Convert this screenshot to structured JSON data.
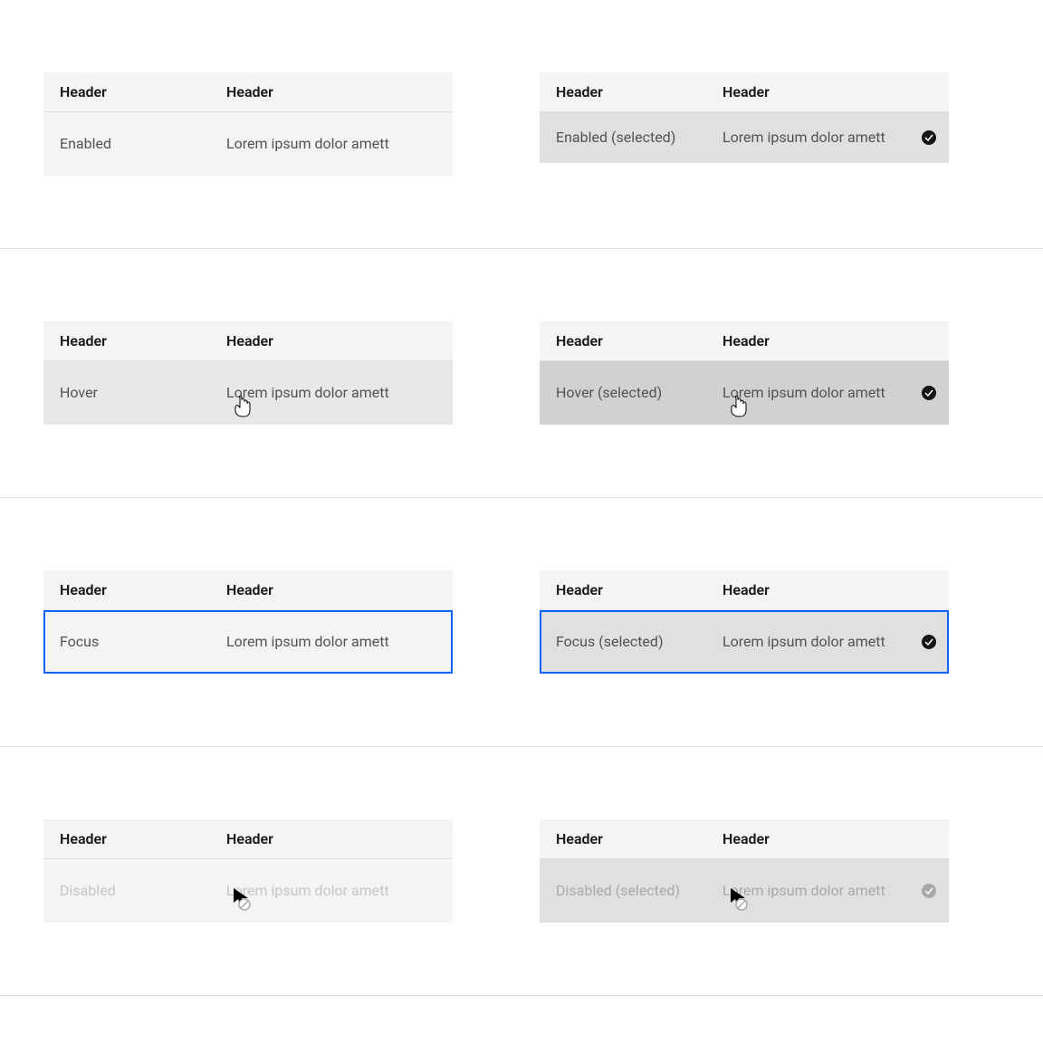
{
  "common": {
    "header1": "Header",
    "header2": "Header",
    "lorem": "Lorem ipsum dolor amett"
  },
  "states": {
    "enabled": "Enabled",
    "enabled_selected": "Enabled (selected)",
    "hover": "Hover",
    "hover_selected": "Hover (selected)",
    "focus": "Focus",
    "focus_selected": "Focus (selected)",
    "disabled": "Disabled",
    "disabled_selected": "Disabled (selected)"
  },
  "colors": {
    "focus_ring": "#0f62fe"
  }
}
